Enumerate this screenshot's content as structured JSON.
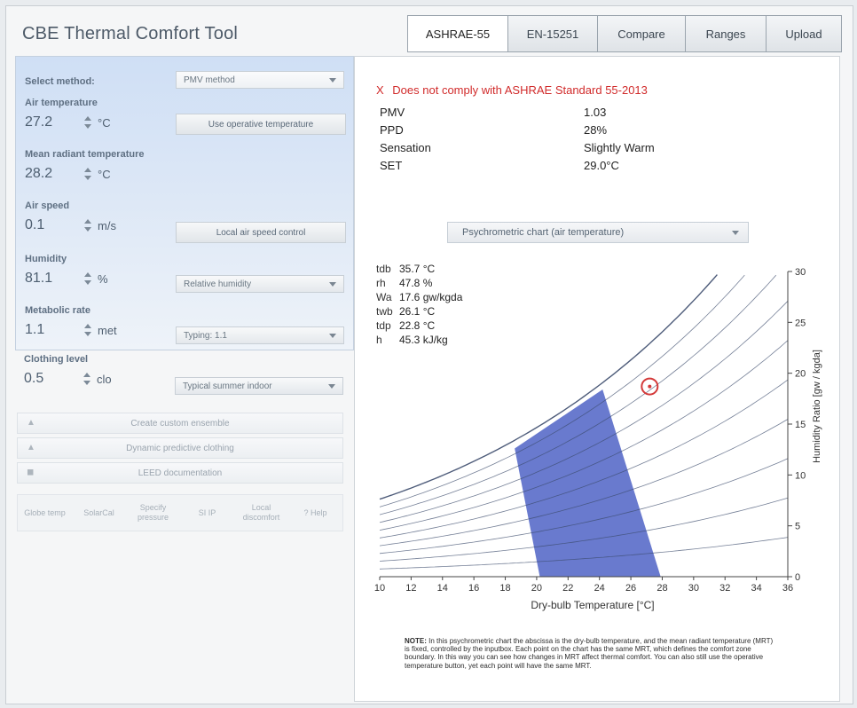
{
  "app": {
    "title": "CBE Thermal Comfort Tool"
  },
  "tabs": [
    "ASHRAE-55",
    "EN-15251",
    "Compare",
    "Ranges",
    "Upload"
  ],
  "controls": {
    "select_method_label": "Select method:",
    "method_value": "PMV method",
    "air_temperature_label": "Air temperature",
    "air_temperature_value": "27.2",
    "air_temperature_unit": "°C",
    "use_operative_btn": "Use operative temperature",
    "mrt_label": "Mean radiant temperature",
    "mrt_value": "28.2",
    "mrt_unit": "°C",
    "air_speed_label": "Air speed",
    "air_speed_value": "0.1",
    "air_speed_unit": "m/s",
    "local_air_speed_btn": "Local air speed control",
    "humidity_label": "Humidity",
    "humidity_value": "81.1",
    "humidity_unit": "%",
    "humidity_mode": "Relative humidity",
    "met_label": "Metabolic rate",
    "met_value": "1.1",
    "met_unit": "met",
    "met_activity": "Typing: 1.1",
    "clo_label": "Clothing level",
    "clo_value": "0.5",
    "clo_unit": "clo",
    "clo_preset": "Typical summer indoor",
    "custom_ensemble_btn": "Create custom ensemble",
    "dynamic_clothing_btn": "Dynamic predictive clothing",
    "leed_btn": "LEED documentation",
    "tools": [
      "Globe temp",
      "SolarCal",
      "Specify pressure",
      "SI IP",
      "Local discomfort",
      "? Help"
    ]
  },
  "results": {
    "compliance_icon": "X",
    "compliance_text": "Does not comply with ASHRAE Standard 55-2013",
    "pmv_label": "PMV",
    "pmv_value": "1.03",
    "ppd_label": "PPD",
    "ppd_value": "28%",
    "sensation_label": "Sensation",
    "sensation_value": "Slightly Warm",
    "set_label": "SET",
    "set_value": "29.0°C"
  },
  "chart_selector": "Psychrometric chart (air temperature)",
  "readout": [
    {
      "sym": "tdb",
      "val": "35.7  °C"
    },
    {
      "sym": "rh",
      "val": "47.8  %"
    },
    {
      "sym": "Wa",
      "val": "17.6  gw/kgda"
    },
    {
      "sym": "twb",
      "val": "26.1  °C"
    },
    {
      "sym": "tdp",
      "val": "22.8  °C"
    },
    {
      "sym": "h",
      "val": "45.3  kJ/kg"
    }
  ],
  "chart_data": {
    "type": "line",
    "xlabel": "Dry-bulb Temperature [°C]",
    "ylabel": "Humidity Ratio [gw / kgda]",
    "xlim": [
      10,
      36
    ],
    "ylim": [
      0,
      30
    ],
    "xticks": [
      10,
      12,
      14,
      16,
      18,
      20,
      22,
      24,
      26,
      28,
      30,
      32,
      34,
      36
    ],
    "yticks": [
      0,
      5,
      10,
      15,
      20,
      25,
      30
    ],
    "rh_curves_percent": [
      10,
      20,
      30,
      40,
      50,
      60,
      70,
      80,
      90,
      100
    ],
    "comfort_zone_polygon": [
      [
        20.2,
        0
      ],
      [
        27.9,
        0
      ],
      [
        24.2,
        18.4
      ],
      [
        18.6,
        12.6
      ]
    ],
    "current_point": {
      "x": 27.2,
      "y": 18.7
    },
    "colors": {
      "zone": "#4f63c6",
      "point": "#d43a3a",
      "curves": "#3b4a6b"
    }
  },
  "note": {
    "title": "NOTE:",
    "text": "In this psychrometric chart the abscissa is the dry-bulb temperature, and the mean radiant temperature (MRT) is fixed, controlled by the inputbox. Each point on the chart has the same MRT, which defines the comfort zone boundary. In this way you can see how changes in MRT affect thermal comfort. You can also still use the operative temperature button, yet each point will have the same MRT."
  }
}
